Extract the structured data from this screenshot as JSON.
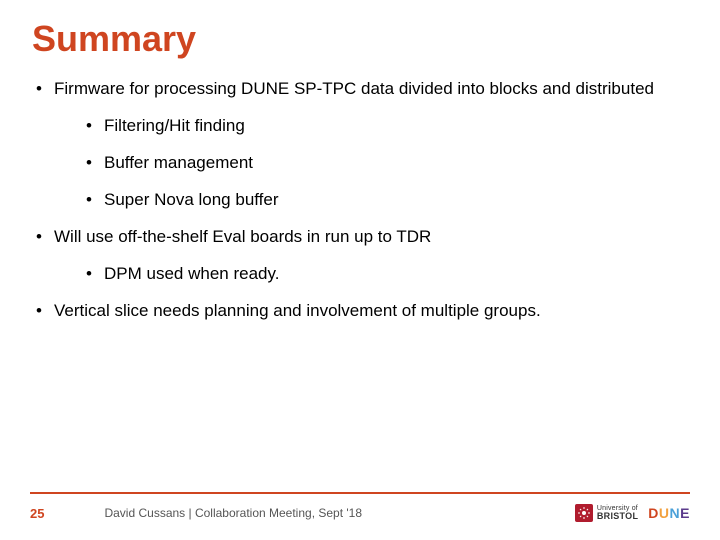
{
  "title": "Summary",
  "bullets": {
    "b1": "Firmware for processing DUNE SP-TPC data divided into blocks and distributed",
    "b1a": "Filtering/Hit finding",
    "b1b": "Buffer management",
    "b1c": "Super Nova long buffer",
    "b2": "Will use off-the-shelf Eval boards in run up to TDR",
    "b2a": "DPM used when ready.",
    "b3": "Vertical slice needs planning and involvement of multiple groups."
  },
  "footer": {
    "page": "25",
    "text": "David Cussans | Collaboration Meeting, Sept '18",
    "bristol_l1": "University of",
    "bristol_l2": "BRISTOL",
    "dune": {
      "d": "D",
      "u": "U",
      "n": "N",
      "e": "E"
    }
  }
}
